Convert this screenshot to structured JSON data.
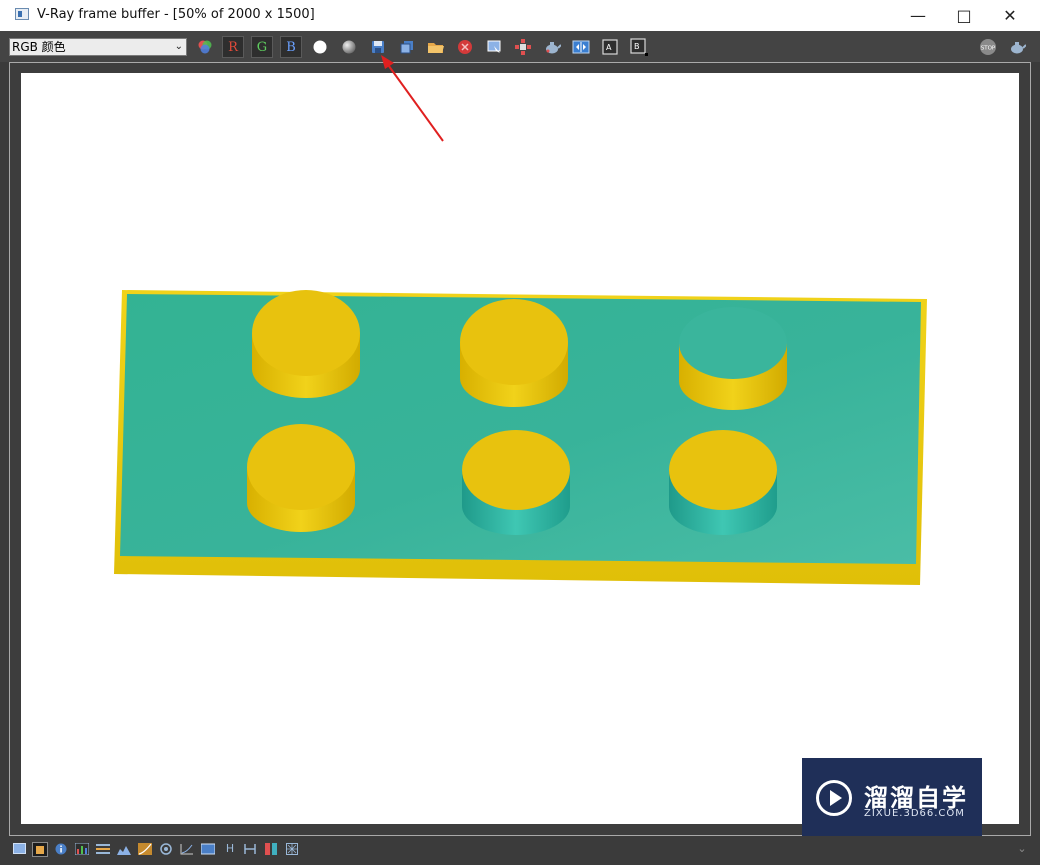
{
  "window": {
    "title": "V-Ray frame buffer - [50% of 2000 x 1500]",
    "controls": [
      "minimize",
      "maximize",
      "close"
    ]
  },
  "toolbar": {
    "channel_select": {
      "value": "RGB 颜色"
    },
    "channel_buttons": [
      {
        "label": "R",
        "color": "#e04a3a"
      },
      {
        "label": "G",
        "color": "#5fcf5f"
      },
      {
        "label": "B",
        "color": "#6aa0ff"
      }
    ],
    "tools": [
      "color-channels-icon",
      "white-circle-icon",
      "gray-sphere-icon",
      "save-image-icon",
      "duplicate-to-frame-buffer-icon",
      "load-image-icon",
      "clear-image-icon",
      "track-mouse-icon",
      "render-region-icon",
      "render-teapot-icon",
      "compare-ab-icon",
      "history-a-icon",
      "history-b-icon"
    ],
    "right_tools": [
      "stop-icon",
      "teapot-render-icon"
    ],
    "stop_label": "STOP"
  },
  "annotation": {
    "color": "#e02020",
    "points_to": "save-image-icon"
  },
  "render": {
    "background": "#ffffff",
    "plate_color": "#3ab59c",
    "stud_color": "#e8c20e"
  },
  "statusbar": {
    "icons": [
      "frame-icon",
      "display-icon",
      "info-icon",
      "histogram-icon",
      "layers-icon",
      "levels-icon",
      "curves-icon",
      "lens-icon",
      "color-correction-icon",
      "lut-icon",
      "h-icon",
      "exposure-icon",
      "color-icon",
      "settings-icon"
    ]
  },
  "watermark": {
    "main_text": "溜溜自学",
    "sub_text": "ZIXUE.3D66.COM"
  }
}
